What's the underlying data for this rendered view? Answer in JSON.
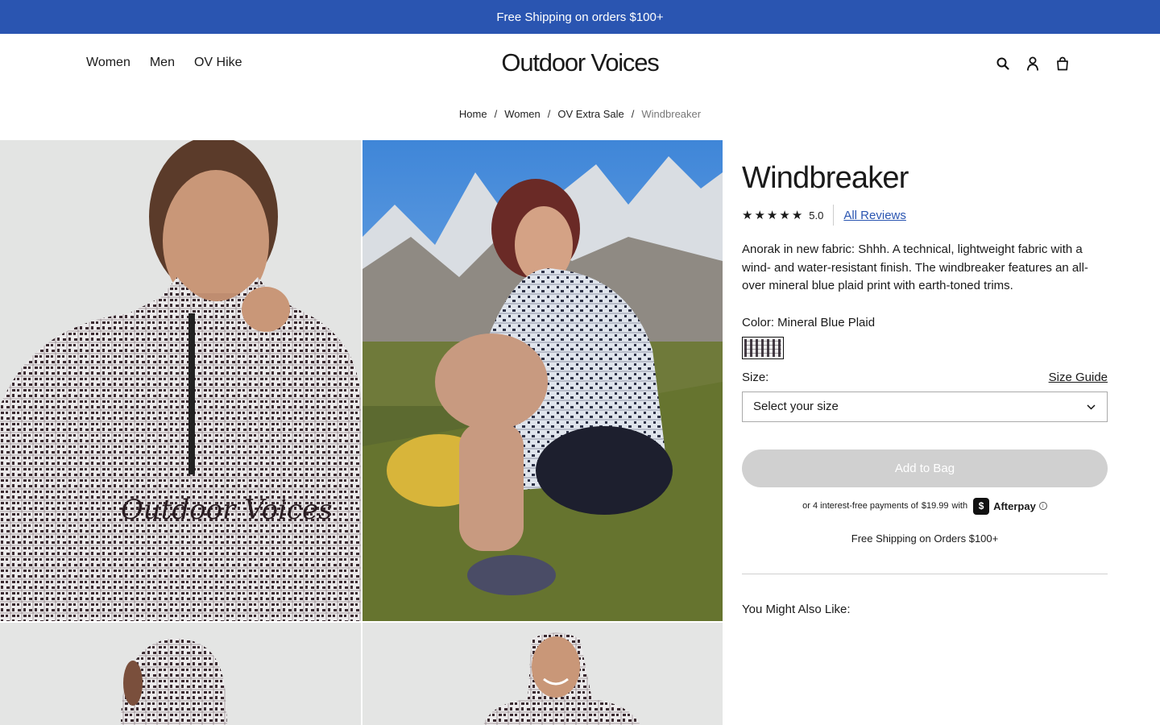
{
  "promo": {
    "text": "Free Shipping on orders $100+"
  },
  "header": {
    "nav": [
      "Women",
      "Men",
      "OV Hike"
    ],
    "logo": "Outdoor Voices",
    "icons": [
      "search-icon",
      "account-icon",
      "bag-icon"
    ]
  },
  "breadcrumb": {
    "items": [
      "Home",
      "Women",
      "OV Extra Sale",
      "Windbreaker"
    ],
    "separator": "/"
  },
  "product": {
    "title": "Windbreaker",
    "stars": [
      "★",
      "★",
      "★",
      "★",
      "★"
    ],
    "rating": "5.0",
    "reviews_link": "All Reviews",
    "description": "Anorak in new fabric: Shhh. A technical, lightweight fabric with a wind- and water-resistant finish. The windbreaker features an all-over mineral blue plaid print with earth-toned trims.",
    "color_label": "Color: Mineral Blue Plaid",
    "size_label": "Size:",
    "size_guide": "Size Guide",
    "size_placeholder": "Select your size",
    "add_to_bag": "Add to Bag",
    "afterpay_prefix": "or 4 interest-free payments of",
    "afterpay_amount": "$19.99",
    "afterpay_with": "with",
    "afterpay_brand": "Afterpay",
    "afterpay_badge": "$",
    "info_glyph": "i",
    "free_shipping": "Free Shipping on Orders $100+",
    "also_like": "You Might Also Like:"
  },
  "colors": {
    "promo_bg": "#2a55b1",
    "link": "#2a55b1",
    "disabled_button": "#d0d0d0"
  }
}
